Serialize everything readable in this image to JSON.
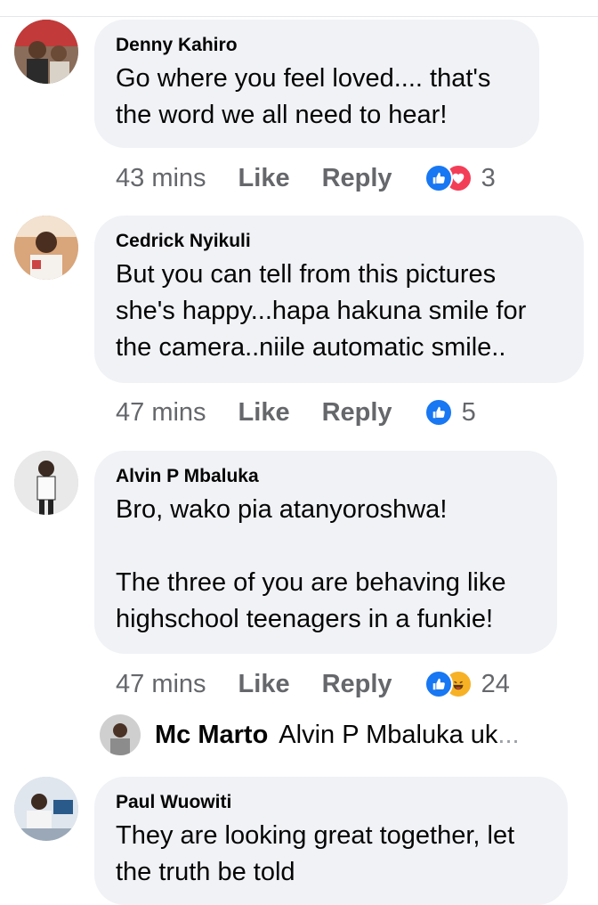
{
  "comments": [
    {
      "author": "Denny Kahiro",
      "text": "Go where you feel loved.... that's\nthe word we all need to hear!",
      "time": "43 mins",
      "like": "Like",
      "reply": "Reply",
      "reactions": [
        "like-icon",
        "love-icon"
      ],
      "reaction_count": "3"
    },
    {
      "author": "Cedrick Nyikuli",
      "text": "But you can tell from this pictures\nshe's happy...hapa hakuna smile for\nthe camera..niile automatic smile..",
      "time": "47 mins",
      "like": "Like",
      "reply": "Reply",
      "reactions": [
        "like-icon"
      ],
      "reaction_count": "5"
    },
    {
      "author": "Alvin P Mbaluka",
      "text": "Bro, wako pia atanyoroshwa!\n\nThe three of you are behaving like\nhighschool teenagers in a funkie!",
      "time": "47 mins",
      "like": "Like",
      "reply": "Reply",
      "reactions": [
        "like-icon",
        "haha-icon"
      ],
      "reaction_count": "24"
    },
    {
      "author": "Paul Wuowiti",
      "text": "They are looking great together, let\nthe truth be told"
    }
  ],
  "reply_preview": {
    "author": "Mc Marto",
    "text": "Alvin P Mbaluka uk",
    "ellipsis": "..."
  },
  "colors": {
    "bubble": "#f0f2f5",
    "meta": "#65676b",
    "like": "#1877f2",
    "love": "#f33e58",
    "haha": "#f7b125"
  }
}
